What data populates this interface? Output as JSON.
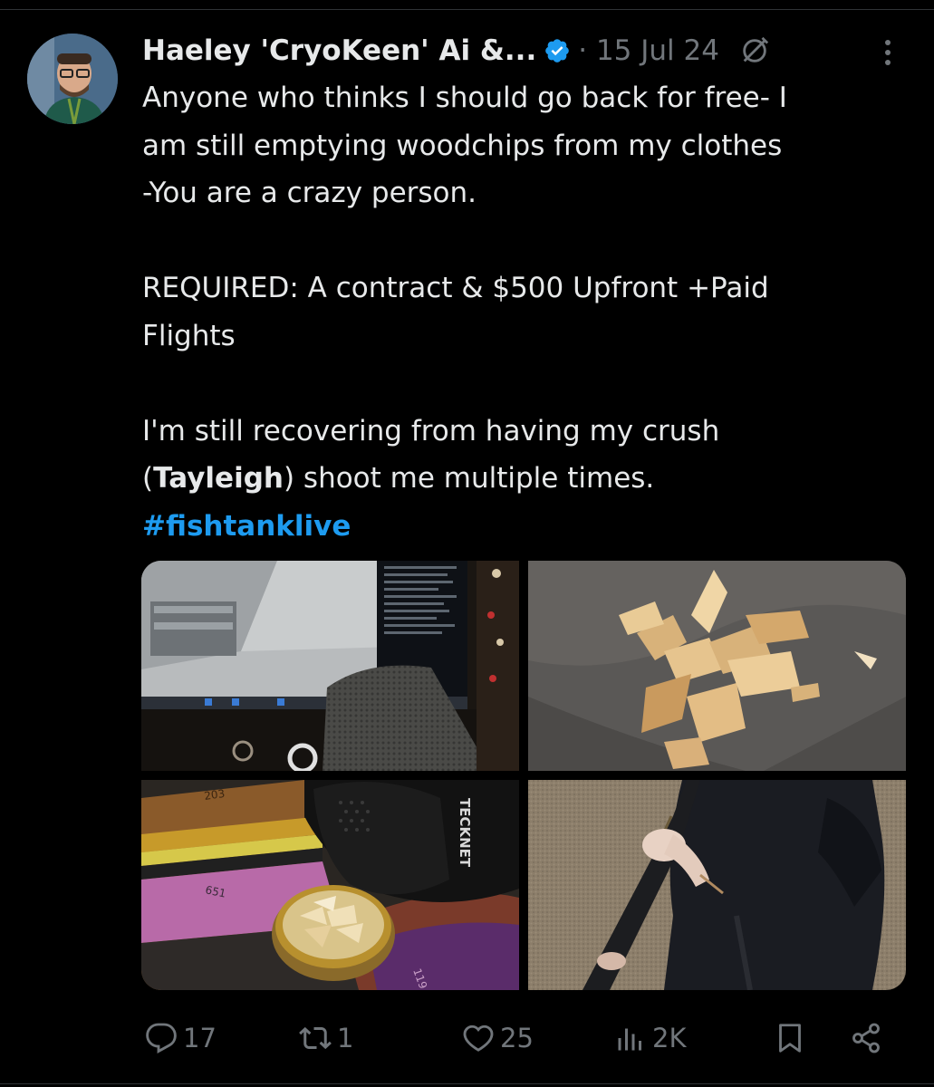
{
  "author": {
    "display_name": "Haeley 'CryoKeen' Ai &...",
    "date": "· 15 Jul 24"
  },
  "tweet": {
    "line1": "Anyone who thinks I should go back for free- I\nam still emptying woodchips from my clothes\n-You are a crazy person.",
    "line2": "REQUIRED: A contract & $500 Upfront +Paid\nFlights",
    "line3_pre": "I'm still recovering from having my crush\n(",
    "line3_bold": "Tayleigh",
    "line3_post": ") shoot me multiple times.",
    "hashtag": "#fishtanklive"
  },
  "media": {
    "tile3_brand": "TECKNET",
    "tile3_rug_a": "203",
    "tile3_rug_b": "651",
    "tile3_rug_c": "119"
  },
  "actions": {
    "replies": "17",
    "reposts": "1",
    "likes": "25",
    "views": "2K"
  },
  "colors": {
    "background": "#000000",
    "text": "#e7e9ea",
    "muted": "#71767b",
    "accent": "#1d9bf0"
  }
}
